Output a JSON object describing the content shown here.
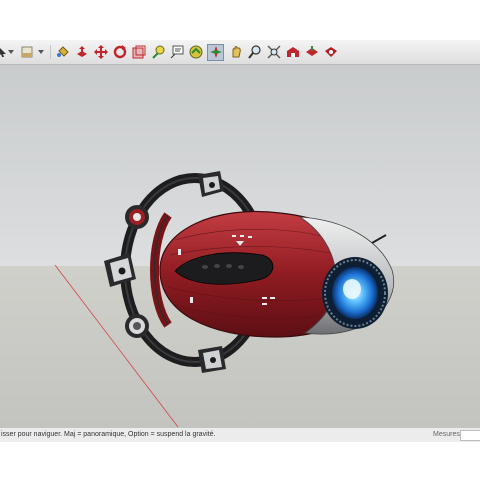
{
  "toolbar": {
    "tools": [
      {
        "name": "select-dropdown-icon"
      },
      {
        "name": "paint-bucket-icon"
      },
      {
        "name": "push-pull-icon"
      },
      {
        "name": "move-icon"
      },
      {
        "name": "rotate-icon"
      },
      {
        "name": "scale-icon"
      },
      {
        "name": "tape-measure-icon"
      },
      {
        "name": "text-tool-icon"
      },
      {
        "name": "protractor-icon"
      },
      {
        "name": "orbit-icon"
      },
      {
        "name": "pan-icon"
      },
      {
        "name": "zoom-icon"
      },
      {
        "name": "zoom-extents-icon"
      },
      {
        "name": "warehouse-icon"
      },
      {
        "name": "share-model-icon"
      },
      {
        "name": "extension-warehouse-icon"
      }
    ],
    "accent_red": "#c0262b",
    "accent_green": "#2e8a2e"
  },
  "statusbar": {
    "message": "isser pour naviguer. Maj = panoramique, Option =  suspend la gravité.",
    "measures_label": "Mesures",
    "measures_value": ""
  },
  "model": {
    "hull_color": "#9a1f25",
    "engine_glow": "#3aa7ff"
  }
}
